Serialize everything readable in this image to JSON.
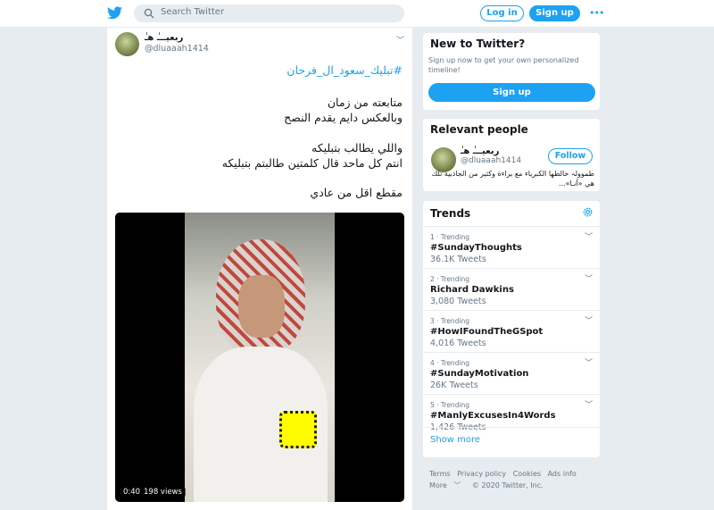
{
  "topbar": {
    "search_placeholder": "Search Twitter",
    "login_label": "Log in",
    "signup_label": "Sign up"
  },
  "tweet": {
    "display_name": "ربعيـــٰ هـٰ",
    "handle": "@dluaaah1414",
    "hashtag": "#تبليك_سعود_ال_فرحان",
    "lines": [
      "متابعته من زمان",
      "وبالعكس دايم يقدم النصح",
      "واللي يطالب بتبليكه",
      "انتم كل ماحد قال كلمتين طالبتم بتبليكه",
      "مقطع اقل من عادي"
    ],
    "video": {
      "duration": "0:40",
      "views": "198 views"
    }
  },
  "new_to_twitter": {
    "title": "New to Twitter?",
    "subtitle": "Sign up now to get your own personalized timeline!",
    "button": "Sign up"
  },
  "relevant_people": {
    "title": "Relevant people",
    "name": "ربعيـــٰ هـٰ",
    "handle": "@dluaaah1414",
    "follow": "Follow",
    "bio": "طموولہ خالطها الكبرياء مع براءة وكثير من الجاذبية تلك هي «أنـا»..."
  },
  "trends": {
    "title": "Trends",
    "items": [
      {
        "meta": "1 · Trending",
        "name": "#SundayThoughts",
        "count": "36.1K Tweets"
      },
      {
        "meta": "2 · Trending",
        "name": "Richard Dawkins",
        "count": "3,080 Tweets"
      },
      {
        "meta": "3 · Trending",
        "name": "#HowIFoundTheGSpot",
        "count": "4,016 Tweets"
      },
      {
        "meta": "4 · Trending",
        "name": "#SundayMotivation",
        "count": "26K Tweets"
      },
      {
        "meta": "5 · Trending",
        "name": "#ManlyExcusesIn4Words",
        "count": "1,426 Tweets"
      }
    ],
    "show_more": "Show more"
  },
  "footer": {
    "links": [
      "Terms",
      "Privacy policy",
      "Cookies",
      "Ads info",
      "More"
    ],
    "copyright": "© 2020 Twitter, Inc."
  },
  "colors": {
    "accent": "#1da1f2",
    "background": "#e6ecf0",
    "muted": "#657786"
  }
}
